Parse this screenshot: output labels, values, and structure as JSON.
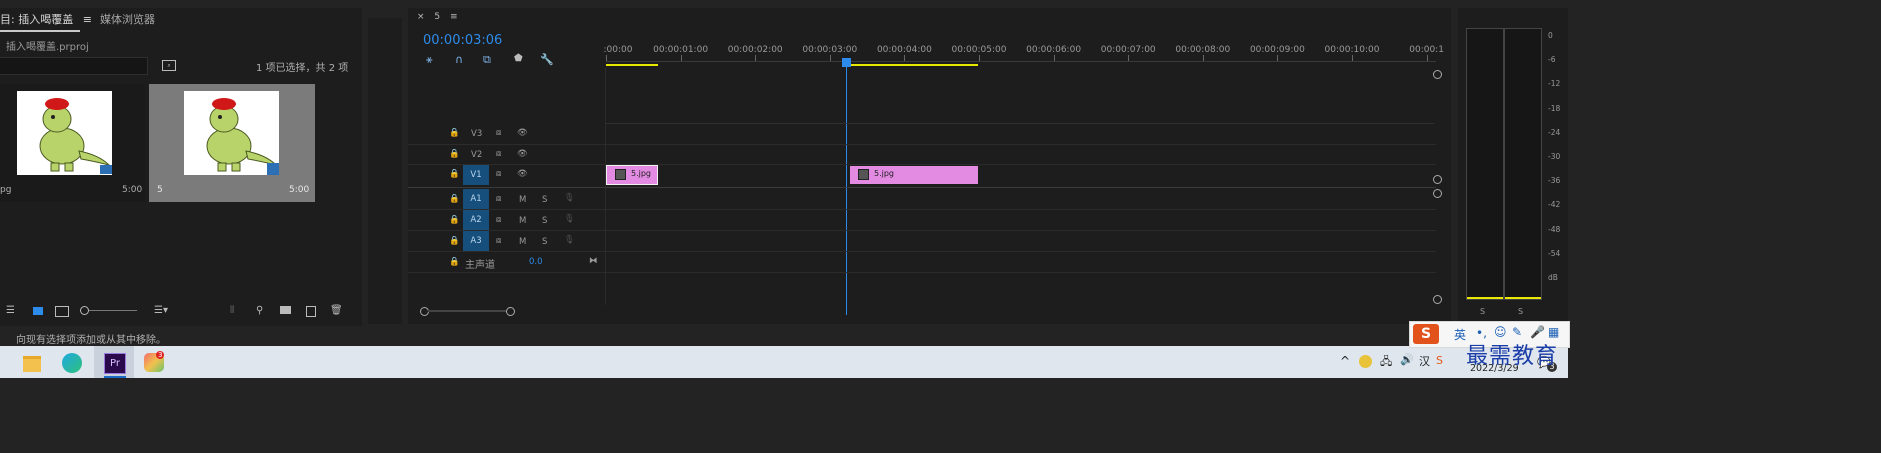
{
  "project": {
    "tab_active": "目: 插入喝覆盖",
    "tab_menu": "≡",
    "tab_media": "媒体浏览器",
    "file": "插入喝覆盖.prproj",
    "selection_info": "1 项已选择，共 2 项",
    "items": [
      {
        "name": "pg",
        "duration": "5:00"
      },
      {
        "name": "5",
        "duration": "5:00"
      }
    ]
  },
  "timeline": {
    "sequence_close": "×",
    "sequence_name": "5",
    "sequence_menu": "≡",
    "timecode": "00:00:03:06",
    "ruler": [
      ":00:00",
      "00:00:01:00",
      "00:00:02:00",
      "00:00:03:00",
      "00:00:04:00",
      "00:00:05:00",
      "00:00:06:00",
      "00:00:07:00",
      "00:00:08:00",
      "00:00:09:00",
      "00:00:10:00",
      "00:00:1"
    ],
    "video_tracks": [
      "V3",
      "V2",
      "V1"
    ],
    "audio_tracks": [
      "A1",
      "A2",
      "A3"
    ],
    "mute_label": "M",
    "solo_label": "S",
    "master": {
      "label": "主声道",
      "value": "0.0"
    },
    "clips": [
      {
        "name": "5.jpg"
      },
      {
        "name": "5.jpg"
      }
    ]
  },
  "meter": {
    "labels": [
      "0",
      "-6",
      "-12",
      "-18",
      "-24",
      "-30",
      "-36",
      "-42",
      "-48",
      "-54",
      "dB"
    ],
    "solo_left": "S",
    "solo_right": "S"
  },
  "status": {
    "message": "向现有选择项添加或从其中移除。"
  },
  "taskbar": {
    "ime_lang": "英",
    "ime_punct": "•,",
    "watermark": "最需教育",
    "date": "2022/3/29",
    "notif_count": "3",
    "app_badge": "3",
    "premiere_label": "Pr"
  },
  "colors": {
    "accent_blue": "#2d8ceb",
    "clip_pink": "#e38ae3",
    "track_target": "#164f7b",
    "playhead": "#2d8ceb",
    "work_area": "#e8e800"
  }
}
